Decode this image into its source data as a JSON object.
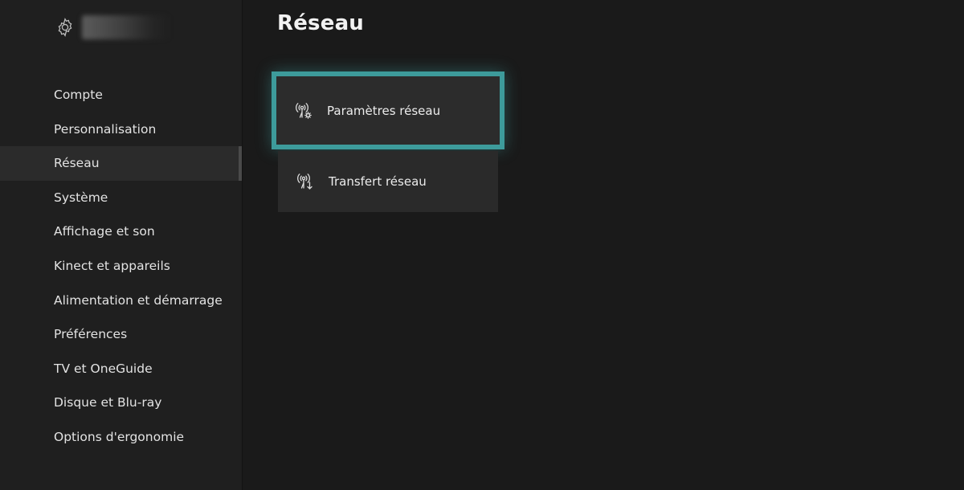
{
  "header": {
    "settings_icon": "gear-icon",
    "account_name": ""
  },
  "sidebar": {
    "items": [
      {
        "label": "Compte",
        "active": false
      },
      {
        "label": "Personnalisation",
        "active": false
      },
      {
        "label": "Réseau",
        "active": true
      },
      {
        "label": "Système",
        "active": false
      },
      {
        "label": "Affichage et son",
        "active": false
      },
      {
        "label": "Kinect et appareils",
        "active": false
      },
      {
        "label": "Alimentation et démarrage",
        "active": false
      },
      {
        "label": "Préférences",
        "active": false
      },
      {
        "label": "TV et OneGuide",
        "active": false
      },
      {
        "label": "Disque et Blu-ray",
        "active": false
      },
      {
        "label": "Options d'ergonomie",
        "active": false
      }
    ]
  },
  "main": {
    "title": "Réseau",
    "tiles": [
      {
        "label": "Paramètres réseau",
        "icon": "network-settings-icon",
        "focused": true
      },
      {
        "label": "Transfert réseau",
        "icon": "network-transfer-icon",
        "focused": false
      }
    ]
  },
  "colors": {
    "focus_border": "#3d9b9b",
    "background": "#1a1a1a",
    "sidebar": "#1f1f1f",
    "tile": "#2a2a2a"
  }
}
